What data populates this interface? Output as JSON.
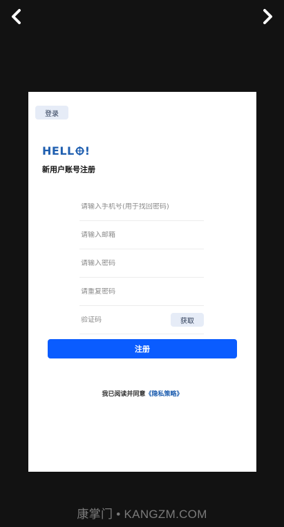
{
  "viewer": {
    "prev_icon": "chevron-left-icon",
    "next_icon": "chevron-right-icon",
    "watermark": "康掌门 • KANGZM.COM"
  },
  "screen": {
    "login_tab": "登录",
    "logo_text": {
      "part1": "HELL",
      "part2": "!"
    },
    "title": "新用户账号注册",
    "fields": {
      "phone_placeholder": "请输入手机号(用于找回密码)",
      "email_placeholder": "请输入邮箱",
      "password_placeholder": "请输入密码",
      "repeat_password_placeholder": "请重复密码",
      "code_placeholder": "验证码"
    },
    "get_code_label": "获取",
    "register_label": "注册",
    "agreement_text": "我已阅读并同意",
    "policy_link": "《隐私策略》"
  },
  "colors": {
    "primary_button": "#0a5cff",
    "logo": "#1f5fb0",
    "secondary_button_bg": "#e6ecf7",
    "viewer_bg": "#121212"
  }
}
